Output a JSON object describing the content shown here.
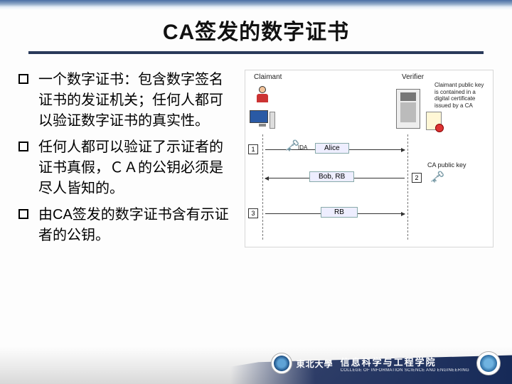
{
  "title": "CA签发的数字证书",
  "bullets": [
    "一个数字证书：包含数字签名证书的发证机关；任何人都可以验证数字证书的真实性。",
    "任何人都可以验证了示证者的证书真假，ＣＡ的公钥必须是尽人皆知的。",
    "由CA签发的数字证书含有示证者的公钥。"
  ],
  "diagram": {
    "claimant_label": "Claimant",
    "verifier_label": "Verifier",
    "note": "Claimant public key is contained in a digital certificate issued by a CA",
    "step1": "1",
    "step2": "2",
    "step3": "3",
    "msg1": "Alice",
    "msg1_icon_label": "IDA",
    "msg2": "Bob, RB",
    "msg3": "RB",
    "ca_key_label": "CA public key"
  },
  "footer": {
    "university_cn": "東北大學",
    "dept_cn": "信息科学与工程学院",
    "dept_en": "COLLEGE OF INFORMATION SCIENCE AND ENGINEERING"
  }
}
